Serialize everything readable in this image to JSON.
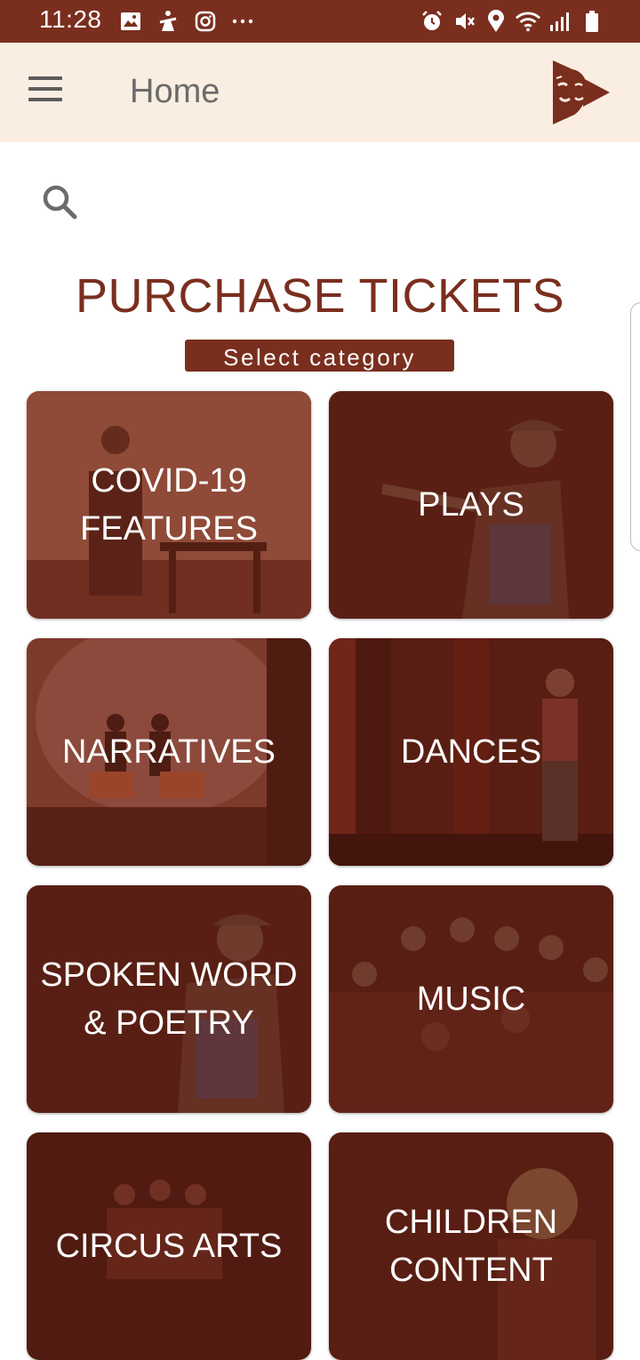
{
  "status_bar": {
    "time": "11:28",
    "left_icons": [
      "image-icon",
      "accessibility-icon",
      "instagram-icon",
      "more-dots-icon"
    ],
    "right_icons": [
      "alarm-icon",
      "mute-icon",
      "location-icon",
      "wifi-icon",
      "signal-icon",
      "battery-icon"
    ]
  },
  "app_bar": {
    "title": "Home",
    "menu_icon": "hamburger-menu-icon",
    "logo_icon": "theatre-mask-play-logo"
  },
  "search": {
    "icon": "search-icon"
  },
  "header": {
    "title": "PURCHASE TICKETS",
    "subtitle": "Select category"
  },
  "categories": [
    {
      "label": "COVID-19\nFEATURES"
    },
    {
      "label": "PLAYS"
    },
    {
      "label": "NARRATIVES"
    },
    {
      "label": "DANCES"
    },
    {
      "label": "SPOKEN WORD\n& POETRY"
    },
    {
      "label": "MUSIC"
    },
    {
      "label": "CIRCUS ARTS"
    },
    {
      "label": "CHILDREN\nCONTENT"
    }
  ],
  "colors": {
    "brand": "#7a2e1e",
    "app_bar_bg": "#faede1",
    "card_overlay": "#5a1f14"
  }
}
